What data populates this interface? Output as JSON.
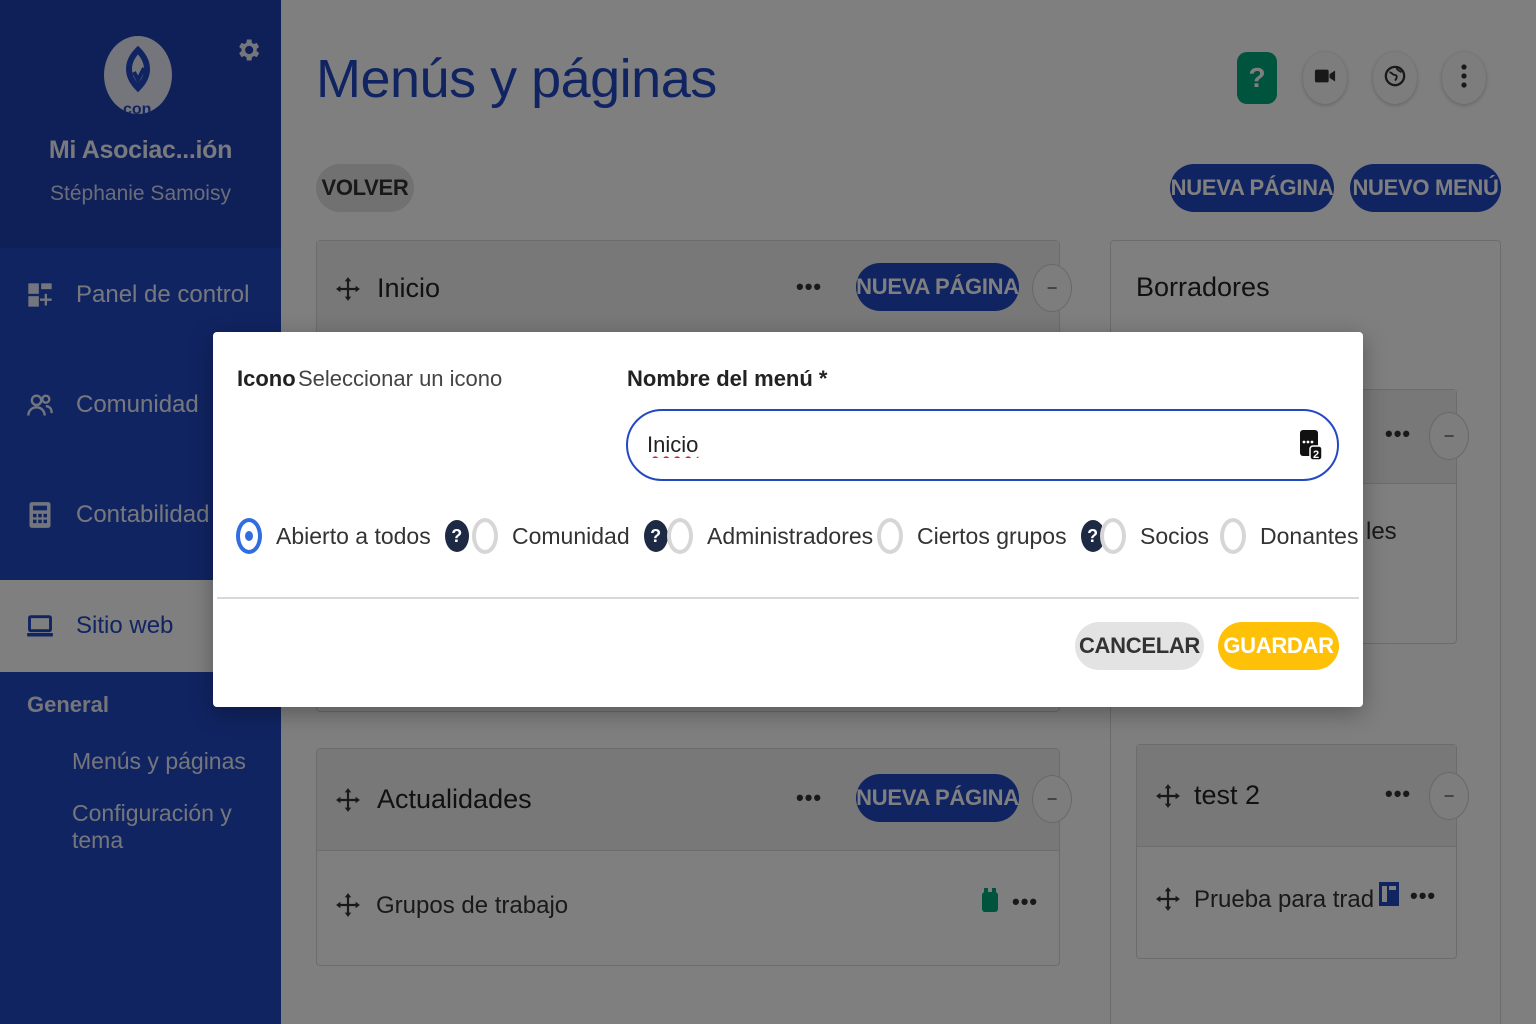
{
  "sidebar": {
    "org_name": "Mi Asociac...ión",
    "user_name": "Stéphanie Samoisy",
    "items": [
      {
        "label": "Panel de control",
        "icon": "dashboard-icon"
      },
      {
        "label": "Comunidad",
        "icon": "people-icon"
      },
      {
        "label": "Contabilidad",
        "icon": "calculator-icon"
      },
      {
        "label": "Sitio web",
        "icon": "laptop-icon"
      }
    ],
    "section_title": "General",
    "sub_links": [
      "Menús y páginas",
      "Configuración y tema"
    ]
  },
  "header": {
    "title": "Menús y páginas",
    "help_label": "?"
  },
  "toolbar": {
    "back_label": "VOLVER",
    "new_page_label": "NUEVA PÁGINA",
    "new_menu_label": "NUEVO MENÚ"
  },
  "menus": [
    {
      "title": "Inicio",
      "new_page_label": "NUEVA PÁGINA",
      "dots": "•••",
      "minus": "−"
    },
    {
      "title": "Actualidades",
      "new_page_label": "NUEVA PÁGINA",
      "dots": "•••",
      "minus": "−",
      "rows": [
        {
          "label": "Grupos de trabajo",
          "dots": "•••"
        }
      ]
    }
  ],
  "drafts": {
    "title": "Borradores",
    "partial_text": "les",
    "dots": "•••",
    "minus": "−",
    "groups": [
      {
        "title": "test 2",
        "dots": "•••",
        "minus": "−",
        "rows": [
          {
            "label": "Prueba para trad",
            "dots": "•••"
          }
        ]
      }
    ]
  },
  "dialog": {
    "icon_label": "Icono",
    "icon_link": "Seleccionar un icono",
    "name_label": "Nombre del menú *",
    "name_value": "Inicio",
    "qmark": "?",
    "visibility_options": [
      {
        "label": "Abierto a todos",
        "checked": true,
        "help": true
      },
      {
        "label": "Comunidad",
        "checked": false,
        "help": true
      },
      {
        "label": "Administradores",
        "checked": false,
        "help": false
      },
      {
        "label": "Ciertos grupos",
        "checked": false,
        "help": true
      },
      {
        "label": "Socios",
        "checked": false,
        "help": false
      },
      {
        "label": "Donantes",
        "checked": false,
        "help": false
      }
    ],
    "cancel_label": "CANCELAR",
    "save_label": "GUARDAR"
  },
  "colors": {
    "brand_blue": "#2348c4",
    "accent_yellow": "#ffc107",
    "help_green": "#00a97a",
    "radio_blue": "#2f6de0"
  }
}
